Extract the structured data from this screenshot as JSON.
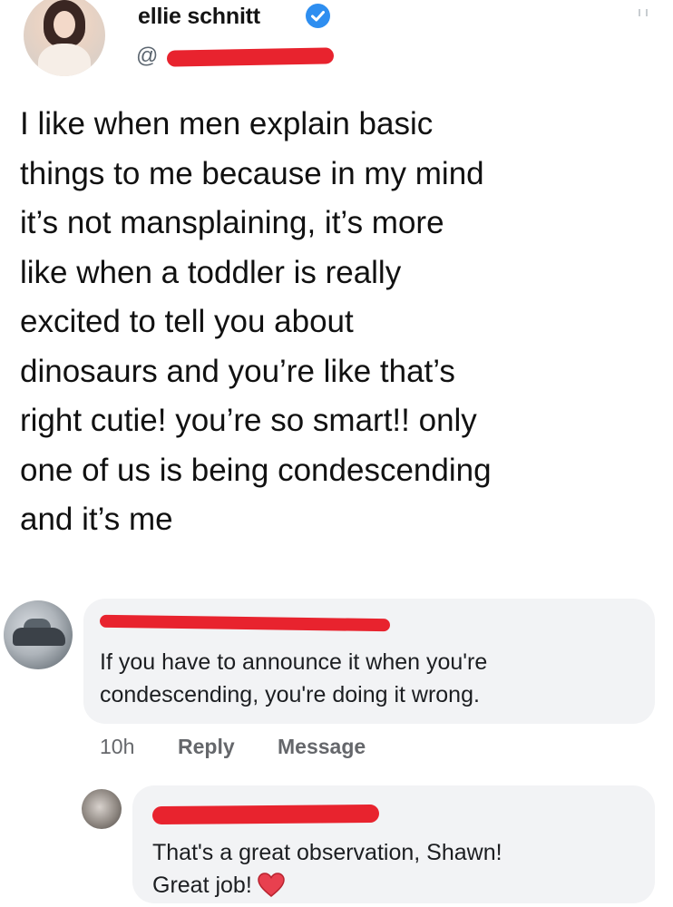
{
  "tweet": {
    "display_name": "ellie schnitt",
    "verified_icon": "verified-badge-icon",
    "handle_prefix": "@",
    "handle_redacted": true,
    "text": "I like when men explain basic\nthings to me because in my mind\nit’s not mansplaining, it’s more\nlike when a toddler is really\nexcited to tell you about\ndinosaurs and you’re like that’s\nright cutie! you’re so smart!! only\none of us is being condescending\nand it’s me"
  },
  "comment": {
    "author_redacted": true,
    "text": "If you have to announce it when you're\ncondescending, you're doing it wrong.",
    "time": "10h",
    "reply_label": "Reply",
    "message_label": "Message"
  },
  "reply": {
    "author_redacted": true,
    "text": "That's a great observation, Shawn!\nGreat job!",
    "emoji_icon": "heart-icon"
  },
  "colors": {
    "redaction": "#e8232e",
    "verified": "#2e8ef0",
    "bubble": "#f2f3f5",
    "action_text": "#65676b"
  }
}
